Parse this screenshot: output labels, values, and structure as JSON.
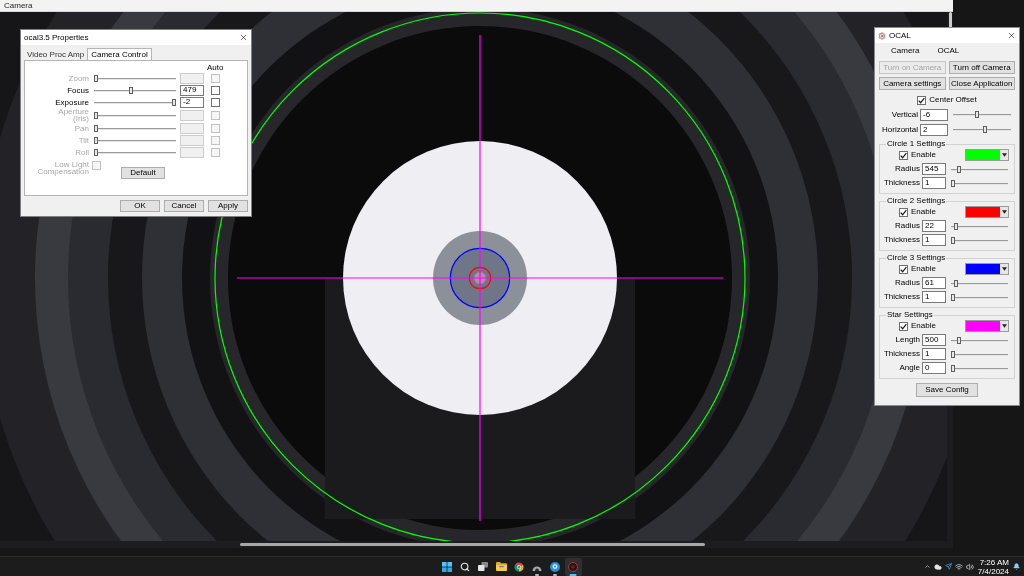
{
  "camera_window": {
    "title": "Camera"
  },
  "properties_dialog": {
    "title": "ocal3.5 Properties",
    "tabs": [
      {
        "label": "Video Proc Amp",
        "selected": false
      },
      {
        "label": "Camera Control",
        "selected": true
      }
    ],
    "auto_header": "Auto",
    "controls": [
      {
        "label": "Zoom",
        "disabled": true,
        "level": 0,
        "checked": false
      },
      {
        "label": "Focus",
        "disabled": false,
        "level": 0.45,
        "value": "479",
        "checked": false
      },
      {
        "label": "Exposure",
        "disabled": false,
        "level": 1,
        "value": "-2",
        "checked": false
      },
      {
        "label": "Aperture (Iris)",
        "disabled": true,
        "level": 0,
        "checked": false
      },
      {
        "label": "Pan",
        "disabled": true,
        "level": 0,
        "checked": false
      },
      {
        "label": "Tilt",
        "disabled": true,
        "level": 0,
        "checked": false
      },
      {
        "label": "Roll",
        "disabled": true,
        "level": 0,
        "checked": false
      }
    ],
    "low_light": {
      "label": "Low Light Compensation",
      "disabled": true,
      "checked": false
    },
    "default_button": "Default",
    "buttons": [
      "OK",
      "Cancel",
      "Apply"
    ]
  },
  "ocal_panel": {
    "title": "OCAL",
    "menu": [
      "Camera",
      "OCAL"
    ],
    "buttons": [
      {
        "label": "Turn on Camera",
        "disabled": true
      },
      {
        "label": "Turn off Camera",
        "disabled": false
      },
      {
        "label": "Camera settings",
        "disabled": false
      },
      {
        "label": "Close Application",
        "disabled": false
      }
    ],
    "center_offset": {
      "label": "Center Offset",
      "checked": true
    },
    "offsets": [
      {
        "label": "Vertical",
        "value": "-6",
        "level": 0.4
      },
      {
        "label": "Horizontal",
        "value": "2",
        "level": 0.55
      }
    ],
    "groups": [
      {
        "kind": "circle",
        "title": "Circle 1 Settings",
        "enable": {
          "label": "Enable",
          "checked": true
        },
        "color": "#00ff00",
        "fields": [
          {
            "label": "Radius",
            "value": "545",
            "level": 0.12
          },
          {
            "label": "Thickness",
            "value": "1",
            "level": 0
          }
        ]
      },
      {
        "kind": "circle",
        "title": "Circle 2 Settings",
        "enable": {
          "label": "Enable",
          "checked": true
        },
        "color": "#ff0000",
        "fields": [
          {
            "label": "Radius",
            "value": "22",
            "level": 0.05
          },
          {
            "label": "Thickness",
            "value": "1",
            "level": 0
          }
        ]
      },
      {
        "kind": "circle",
        "title": "Circle 3 Settings",
        "enable": {
          "label": "Enable",
          "checked": true
        },
        "color": "#0000ff",
        "fields": [
          {
            "label": "Radius",
            "value": "61",
            "level": 0.05
          },
          {
            "label": "Thickness",
            "value": "1",
            "level": 0
          }
        ]
      },
      {
        "kind": "star",
        "title": "Star Settings",
        "enable": {
          "label": "Enable",
          "checked": true
        },
        "color": "#ff00ff",
        "fields": [
          {
            "label": "Length",
            "value": "500",
            "level": 0.12
          },
          {
            "label": "Thickness",
            "value": "1",
            "level": 0
          },
          {
            "label": "Angle",
            "value": "0",
            "level": 0
          }
        ]
      }
    ],
    "save_button": "Save Config"
  },
  "taskbar": {
    "items": [
      {
        "kind": "start"
      },
      {
        "kind": "search"
      },
      {
        "kind": "taskview"
      },
      {
        "kind": "folder",
        "running": false,
        "active": false
      },
      {
        "kind": "browser",
        "running": false,
        "active": false
      },
      {
        "kind": "dome",
        "running": true,
        "active": false
      },
      {
        "kind": "disc",
        "running": true,
        "active": false
      },
      {
        "kind": "lens",
        "running": true,
        "active": true
      }
    ],
    "clock": {
      "time": "7:26 AM",
      "date": "7/4/2024"
    }
  }
}
